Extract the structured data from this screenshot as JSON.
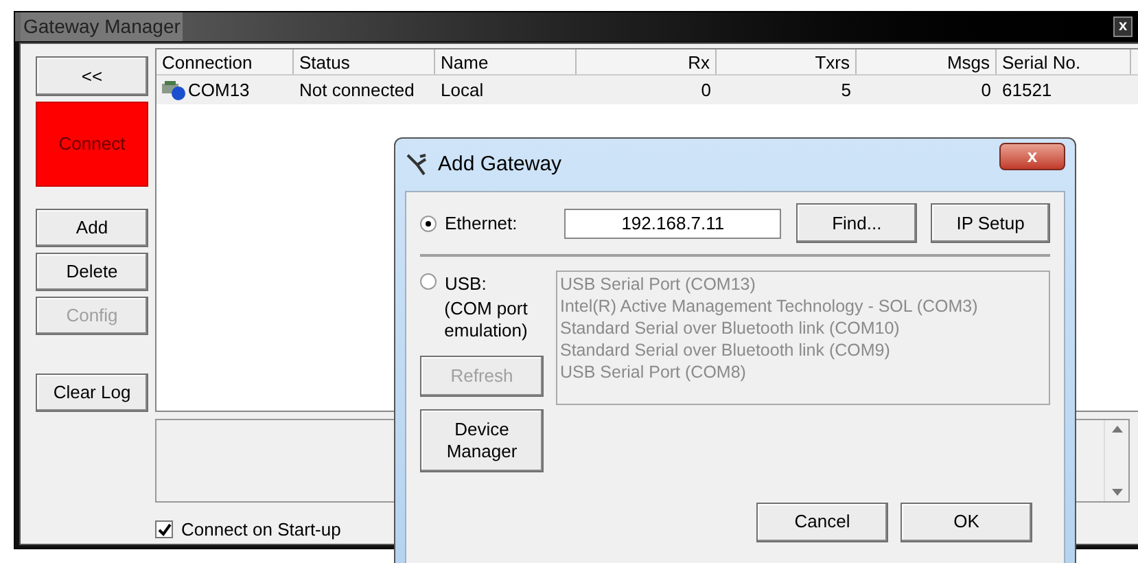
{
  "window": {
    "title": "Gateway Manager",
    "close": "x"
  },
  "side_buttons": [
    {
      "label": "<<",
      "kind": "plain",
      "disabled": false
    },
    {
      "label": "Connect",
      "kind": "alert",
      "disabled": false
    },
    {
      "label": "Add",
      "kind": "plain",
      "disabled": false
    },
    {
      "label": "Delete",
      "kind": "plain",
      "disabled": false
    },
    {
      "label": "Config",
      "kind": "plain",
      "disabled": true
    },
    {
      "label": "Clear Log",
      "kind": "plain",
      "disabled": false
    }
  ],
  "table": {
    "columns": [
      "Connection",
      "Status",
      "Name",
      "Rx",
      "Txrs",
      "Msgs",
      "Serial No."
    ],
    "rows": [
      {
        "cells": [
          "COM13",
          "Not connected",
          "Local",
          "0",
          "5",
          "0",
          "61521"
        ]
      }
    ]
  },
  "connect_on_startup": {
    "label": "Connect on Start-up",
    "checked": true
  },
  "dialog": {
    "title": "Add Gateway",
    "close": "x",
    "ethernet": {
      "label": "Ethernet:",
      "selected": true,
      "value": "192.168.7.11"
    },
    "find_button": "Find...",
    "ip_setup_button": "IP Setup",
    "usb": {
      "label": "USB:",
      "note": "(COM port emulation)",
      "selected": false
    },
    "refresh": {
      "label": "Refresh",
      "disabled": true
    },
    "device_manager_button": "Device Manager",
    "ports": [
      "USB Serial Port (COM13)",
      "Intel(R) Active Management Technology - SOL (COM3)",
      "Standard Serial over Bluetooth link (COM10)",
      "Standard Serial over Bluetooth link (COM9)",
      "USB Serial Port (COM8)"
    ],
    "buttons": [
      "Cancel",
      "OK"
    ]
  }
}
